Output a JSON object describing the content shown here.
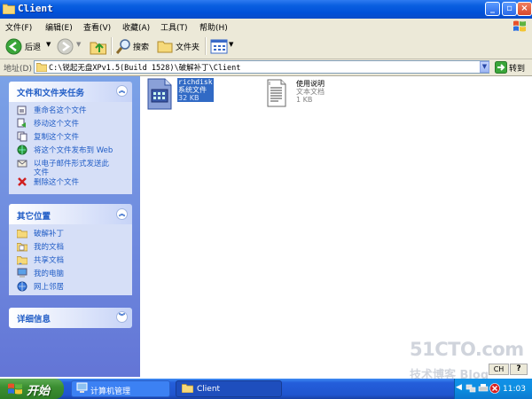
{
  "window": {
    "title": "Client"
  },
  "menu": [
    "文件(F)",
    "编辑(E)",
    "查看(V)",
    "收藏(A)",
    "工具(T)",
    "帮助(H)"
  ],
  "toolbar": {
    "back_label": "后退",
    "search_label": "搜索",
    "folders_label": "文件夹"
  },
  "address": {
    "label": "地址(D)",
    "path": "C:\\锐起无盘XPv1.5(Build 1528)\\破解补丁\\Client",
    "go_label": "转到"
  },
  "file_tasks": {
    "title": "文件和文件夹任务",
    "items": [
      {
        "label": "重命名这个文件",
        "icon": "rename-icon"
      },
      {
        "label": "移动这个文件",
        "icon": "move-icon"
      },
      {
        "label": "复制这个文件",
        "icon": "copy-icon"
      },
      {
        "label": "将这个文件发布到 Web",
        "icon": "publish-web-icon"
      },
      {
        "label": "以电子邮件形式发送此",
        "label2": "文件",
        "icon": "email-icon"
      },
      {
        "label": "删除这个文件",
        "icon": "delete-icon"
      }
    ]
  },
  "other_places": {
    "title": "其它位置",
    "items": [
      {
        "label": "破解补丁",
        "icon": "folder-icon"
      },
      {
        "label": "我的文档",
        "icon": "my-documents-icon"
      },
      {
        "label": "共享文档",
        "icon": "shared-documents-icon"
      },
      {
        "label": "我的电脑",
        "icon": "my-computer-icon"
      },
      {
        "label": "网上邻居",
        "icon": "network-places-icon"
      }
    ]
  },
  "details": {
    "title": "详细信息"
  },
  "files": [
    {
      "name": "richdisk",
      "type": "系统文件",
      "size": "32 KB",
      "selected": true
    },
    {
      "name": "使用说明",
      "type": "文本文档",
      "size": "1 KB",
      "selected": false
    }
  ],
  "watermark": {
    "line1": "51CTO.com",
    "line2": "技术博客 Blog"
  },
  "language_indicator": "CH",
  "taskbar": {
    "start_label": "开始",
    "buttons": [
      {
        "label": "计算机管理",
        "active": false
      },
      {
        "label": "Client",
        "active": true
      }
    ],
    "clock": "11:03"
  },
  "colors": {
    "titlebar": "#0a5fe0",
    "selection": "#316ac5",
    "task_link": "#215dc6",
    "taskbar": "#245edb",
    "start": "#3c8f32"
  }
}
